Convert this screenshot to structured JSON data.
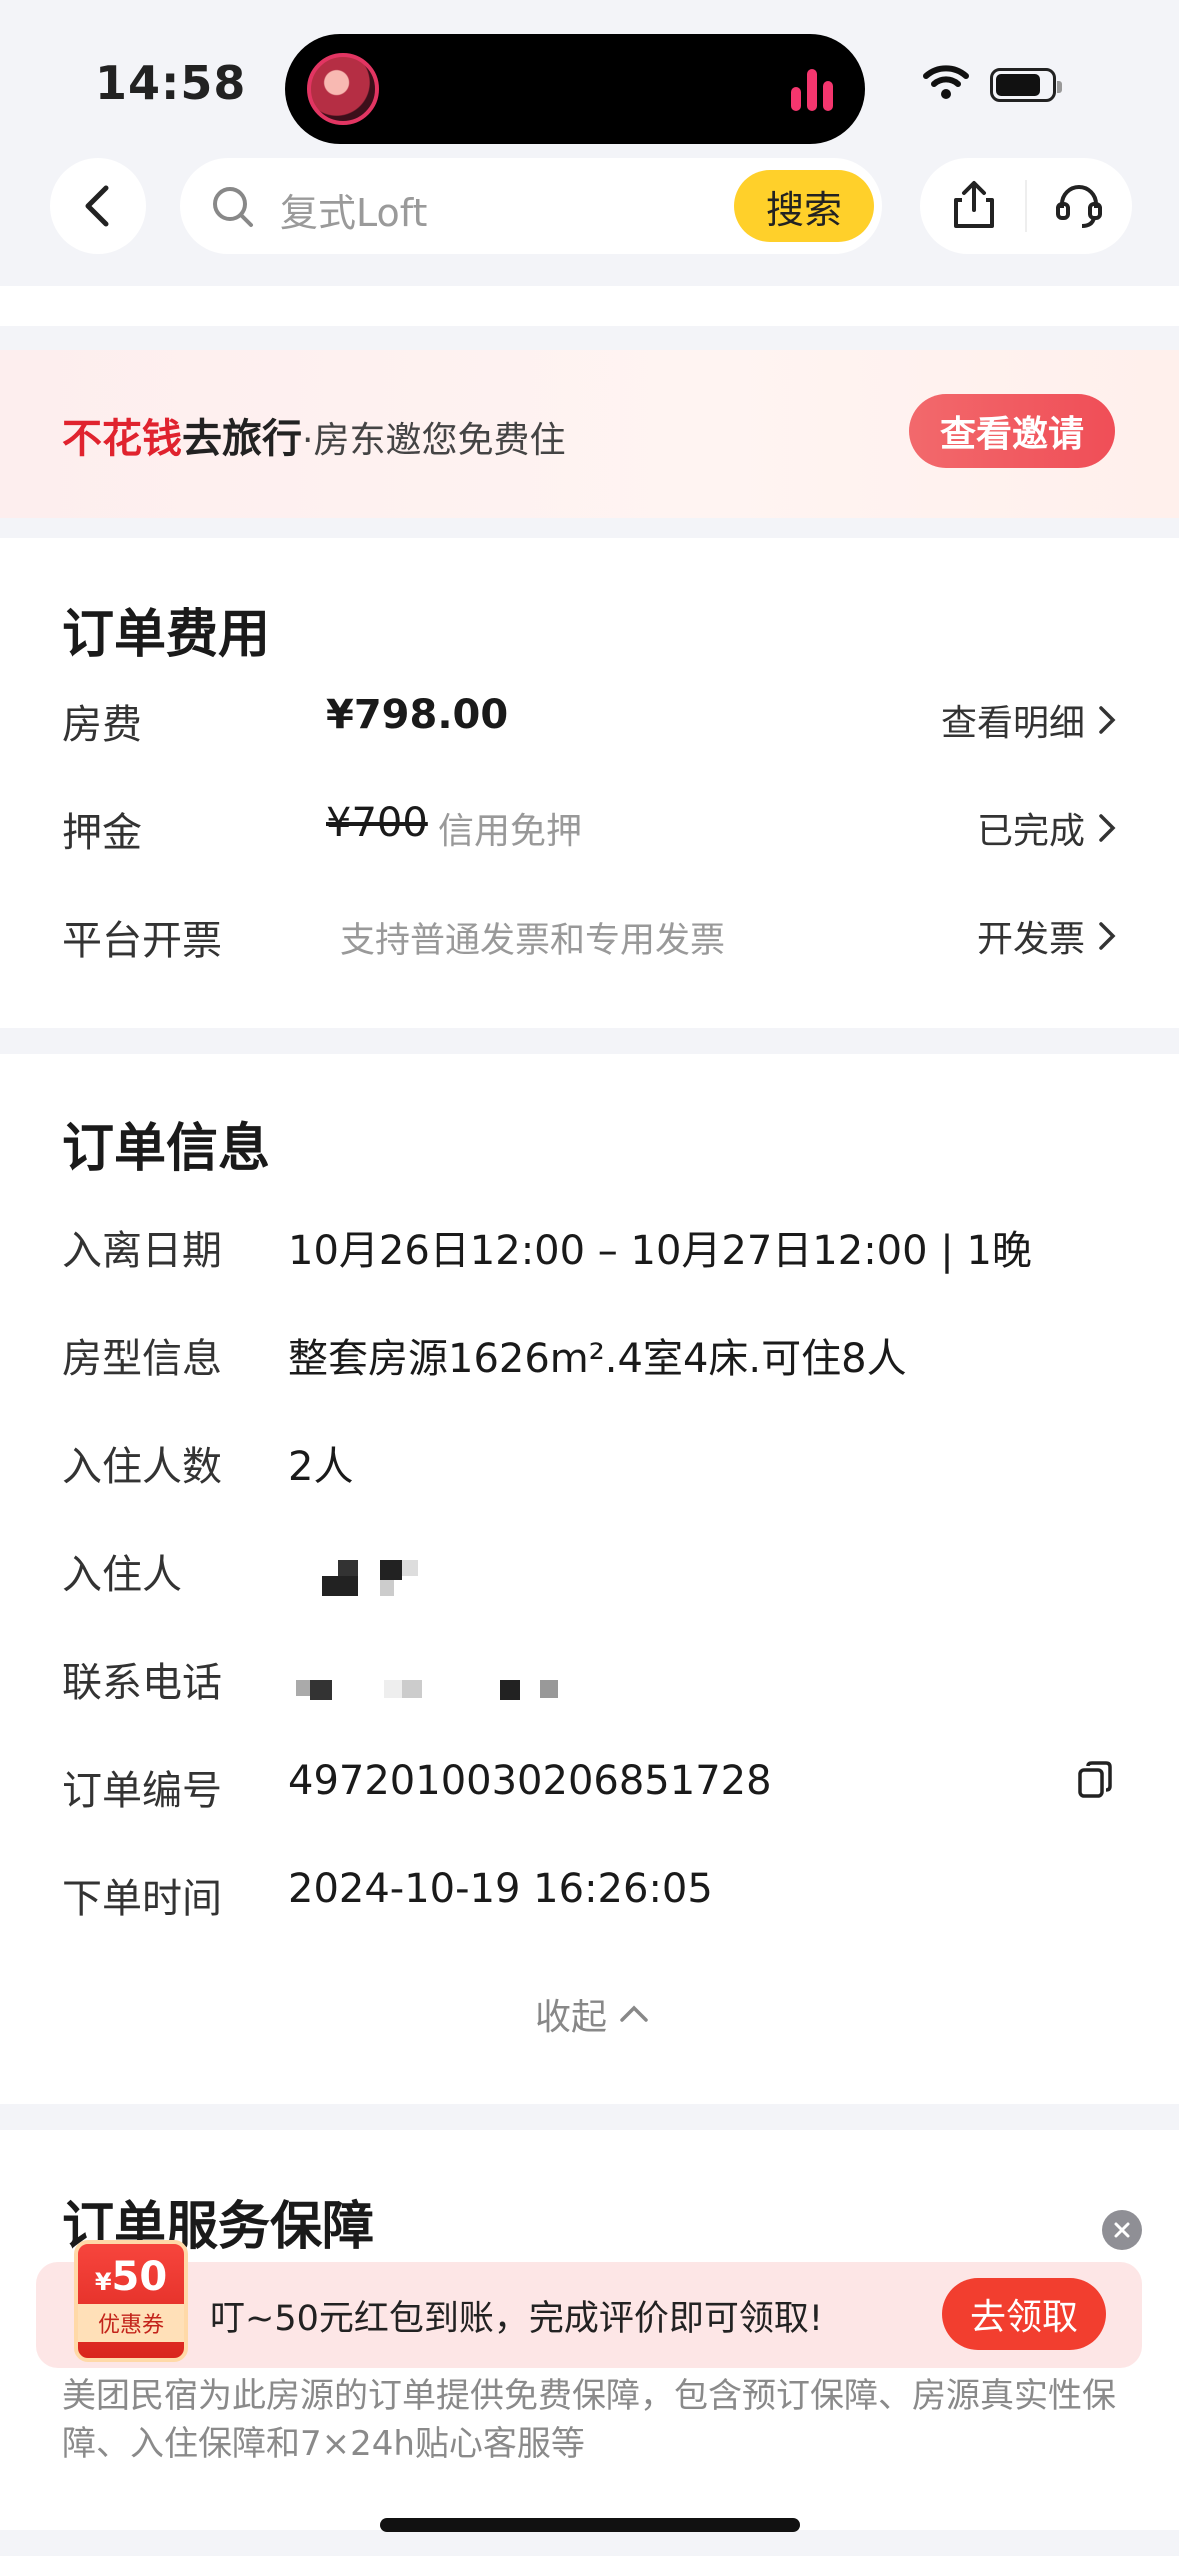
{
  "status_bar": {
    "time": "14:58"
  },
  "search": {
    "placeholder": "复式Loft",
    "button": "搜索"
  },
  "banner": {
    "highlight": "不花钱",
    "title": "去旅行",
    "subtitle": "·房东邀您免费住",
    "button": "查看邀请"
  },
  "fee": {
    "title": "订单费用",
    "rows": [
      {
        "label": "房费",
        "value": "¥798.00",
        "note": "",
        "action": "查看明细"
      },
      {
        "label": "押金",
        "value": "¥700",
        "note": "信用免押",
        "action": "已完成"
      },
      {
        "label": "平台开票",
        "value": "",
        "note": "支持普通发票和专用发票",
        "action": "开发票"
      }
    ]
  },
  "info": {
    "title": "订单信息",
    "rows": [
      {
        "label": "入离日期",
        "value": "10月26日12:00 – 10月27日12:00 | 1晚"
      },
      {
        "label": "房型信息",
        "value": "整套房源1626m².4室4床.可住8人"
      },
      {
        "label": "入住人数",
        "value": "2人"
      },
      {
        "label": "入住人",
        "value": ""
      },
      {
        "label": "联系电话",
        "value": ""
      },
      {
        "label": "订单编号",
        "value": "4972010030206851728"
      },
      {
        "label": "下单时间",
        "value": "2024-10-19 16:26:05"
      }
    ],
    "collapse": "收起"
  },
  "guarantee": {
    "title": "订单服务保障",
    "text": "美团民宿为此房源的订单提供免费保障，包含预订保障、房源真实性保障、入住保障和7×24h贴心客服等"
  },
  "toast": {
    "coupon_symbol": "¥",
    "coupon_amount": "50",
    "coupon_label": "优惠券",
    "message": "叮~50元红包到账，完成评价即可领取!",
    "button": "去领取"
  },
  "colors": {
    "accent_yellow": "#ffd02a",
    "accent_red": "#f04e57",
    "brand_red": "#e0232e"
  }
}
